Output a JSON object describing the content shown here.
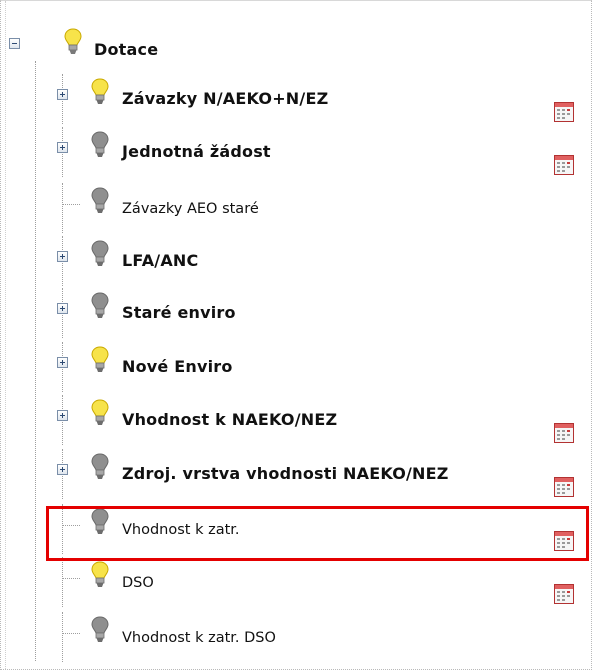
{
  "tree": {
    "root": {
      "label": "Dotace",
      "bulb": "on",
      "expanded": true
    },
    "items": [
      {
        "label": "Závazky N/AEKO+N/EZ",
        "bold": true,
        "bulb": "on",
        "expander": "plus",
        "calendar": true
      },
      {
        "label": "Jednotná žádost",
        "bold": true,
        "bulb": "off",
        "expander": "plus",
        "calendar": true
      },
      {
        "label": "Závazky AEO staré",
        "bold": false,
        "bulb": "off",
        "expander": "none",
        "calendar": false
      },
      {
        "label": "LFA/ANC",
        "bold": true,
        "bulb": "off",
        "expander": "plus",
        "calendar": false
      },
      {
        "label": "Staré enviro",
        "bold": true,
        "bulb": "off",
        "expander": "plus",
        "calendar": false
      },
      {
        "label": "Nové Enviro",
        "bold": true,
        "bulb": "on",
        "expander": "plus",
        "calendar": false
      },
      {
        "label": "Vhodnost k NAEKO/NEZ",
        "bold": true,
        "bulb": "on",
        "expander": "plus",
        "calendar": true
      },
      {
        "label": "Zdroj. vrstva vhodnosti NAEKO/NEZ",
        "bold": true,
        "bulb": "off",
        "expander": "plus",
        "calendar": true
      },
      {
        "label": "Vhodnost k zatr.",
        "bold": false,
        "bulb": "off",
        "expander": "none",
        "calendar": true,
        "highlighted": true
      },
      {
        "label": "DSO",
        "bold": false,
        "bulb": "on",
        "expander": "none",
        "calendar": true
      },
      {
        "label": "Vhodnost k zatr. DSO",
        "bold": false,
        "bulb": "off",
        "expander": "none",
        "calendar": false
      }
    ]
  },
  "colors": {
    "bulb_on": "#f7e34a",
    "bulb_off": "#8f8f8f",
    "highlight": "#e40000",
    "calendar_accent": "#c83a3a"
  },
  "icons": {
    "bulb": "lightbulb-icon",
    "calendar": "calendar-icon",
    "expand": "plus-box-icon",
    "collapse": "minus-box-icon"
  }
}
